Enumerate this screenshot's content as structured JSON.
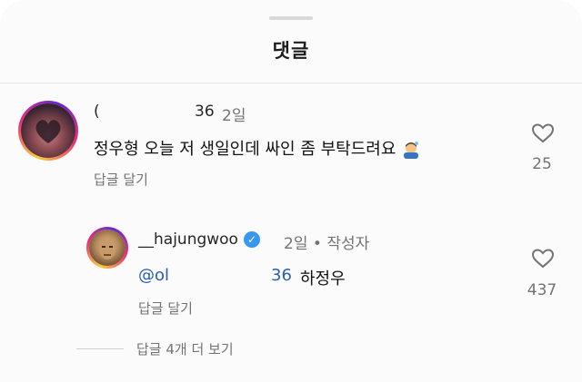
{
  "sheet": {
    "title": "댓글"
  },
  "comments": [
    {
      "username_start": "(",
      "username_end": "36",
      "time": "2일",
      "text": "정우형 오늘 저 생일인데 싸인 좀 부탁드려요",
      "emoji": "bowing-person-emoji",
      "reply_label": "답글 달기",
      "likes": "25"
    }
  ],
  "reply": {
    "username": "__hajungwoo",
    "verified": true,
    "time": "2일",
    "separator": "•",
    "author_tag": "작성자",
    "mention_start": "@ol",
    "mention_end": "36",
    "text": "하정우",
    "reply_label": "답글 달기",
    "likes": "437"
  },
  "more_replies_label": "답글 4개 더 보기",
  "colors": {
    "mention": "#2b5cb0",
    "verified": "#3897f0",
    "muted": "#737373"
  }
}
